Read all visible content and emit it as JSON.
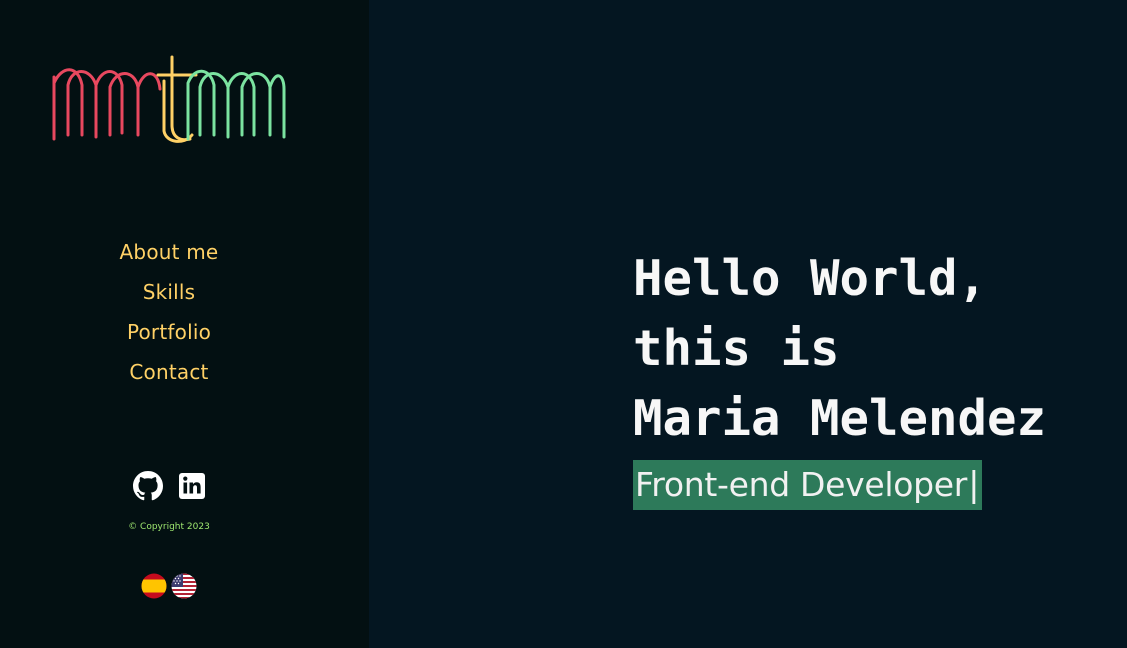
{
  "sidebar": {
    "logo_text": "mtm",
    "nav": [
      {
        "label": "About me"
      },
      {
        "label": "Skills"
      },
      {
        "label": "Portfolio"
      },
      {
        "label": "Contact"
      }
    ],
    "social": [
      {
        "icon": "github-icon"
      },
      {
        "icon": "linkedin-icon"
      }
    ],
    "copyright": "© Copyright 2023",
    "languages": [
      {
        "icon": "spain-flag-icon"
      },
      {
        "icon": "usa-flag-icon"
      }
    ]
  },
  "hero": {
    "line1": "Hello World,",
    "line2": "this is",
    "line3": "Maria Melendez",
    "role": "Front-end Developer",
    "cursor": "|"
  },
  "colors": {
    "sidebar_bg": "#031012",
    "main_bg": "#041621",
    "nav_text": "#ffd166",
    "role_highlight": "#2d7a5a",
    "logo_red": "#e8485f",
    "logo_yellow": "#ffd166",
    "logo_green": "#7be3a0"
  }
}
